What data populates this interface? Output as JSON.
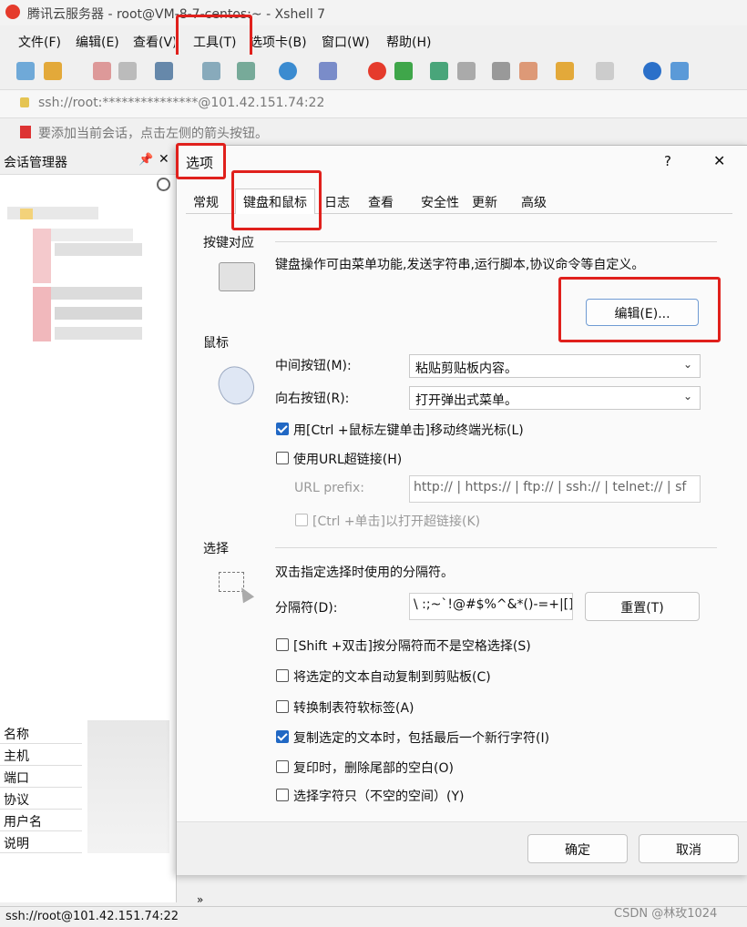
{
  "window": {
    "title": "腾讯云服务器 - root@VM-8-7-centos:~ - Xshell 7",
    "menu": [
      "文件(F)",
      "编辑(E)",
      "查看(V)",
      "工具(T)",
      "选项卡(B)",
      "窗口(W)",
      "帮助(H)"
    ],
    "address": "ssh://root:***************@101.42.151.74:22",
    "tip": "要添加当前会话，点击左侧的箭头按钮。"
  },
  "session_manager": {
    "title": "会话管理器",
    "props": [
      "名称",
      "主机",
      "端口",
      "协议",
      "用户名",
      "说明"
    ]
  },
  "status": {
    "left": "ssh://root@101.42.151.74:22",
    "watermark": "CSDN @林玫1024"
  },
  "dialog": {
    "title": "选项",
    "help": "?",
    "close": "✕",
    "tabs": [
      "常规",
      "键盘和鼠标",
      "日志",
      "查看",
      "安全性",
      "更新",
      "高级"
    ],
    "keyboard": {
      "section": "按键对应",
      "desc": "键盘操作可由菜单功能,发送字符串,运行脚本,协议命令等自定义。",
      "edit_button": "编辑(E)..."
    },
    "mouse": {
      "section": "鼠标",
      "middle_label": "中间按钮(M):",
      "middle_value": "粘贴剪贴板内容。",
      "right_label": "向右按钮(R):",
      "right_value": "打开弹出式菜单。",
      "ctrl_click": "用[Ctrl +鼠标左键单击]移动终端光标(L)",
      "use_url": "使用URL超链接(H)",
      "url_prefix_label": "URL prefix:",
      "url_prefix_value": "http:// | https:// | ftp:// | ssh:// | telnet:// | sf",
      "ctrl_url": "[Ctrl +单击]以打开超链接(K)"
    },
    "selection": {
      "section": "选择",
      "desc": "双击指定选择时使用的分隔符。",
      "sep_label": "分隔符(D):",
      "sep_value": "\\ :;~`!@#$%^&*()-=+|[]{",
      "reset_button": "重置(T)",
      "opts": [
        {
          "label": "[Shift +双击]按分隔符而不是空格选择(S)",
          "checked": false
        },
        {
          "label": "将选定的文本自动复制到剪贴板(C)",
          "checked": false
        },
        {
          "label": "转换制表符软标签(A)",
          "checked": false
        },
        {
          "label": "复制选定的文本时，包括最后一个新行字符(I)",
          "checked": true
        },
        {
          "label": "复印时，删除尾部的空白(O)",
          "checked": false
        },
        {
          "label": "选择字符只（不空的空间）(Y)",
          "checked": false
        }
      ]
    },
    "ok": "确定",
    "cancel": "取消"
  },
  "colors": {
    "highlight": "#e0201c",
    "accent": "#2168c4"
  }
}
